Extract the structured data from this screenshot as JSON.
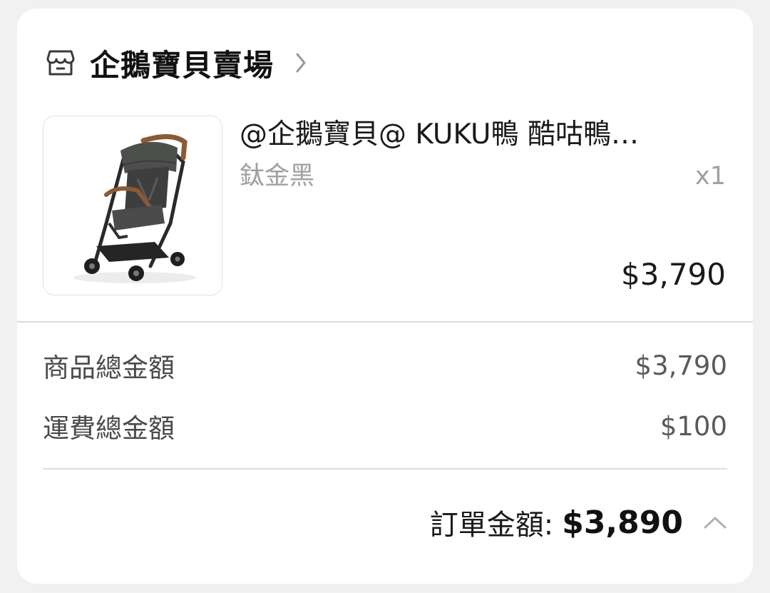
{
  "shop": {
    "name": "企鵝寶貝賣場"
  },
  "product": {
    "title": "@企鵝寶貝@ KUKU鴨 酷咕鴨…",
    "variant": "鈦金黑",
    "quantity": "x1",
    "price": "$3,790",
    "image_alt": "stroller"
  },
  "summary": {
    "subtotal_label": "商品總金額",
    "subtotal_value": "$3,790",
    "shipping_label": "運費總金額",
    "shipping_value": "$100"
  },
  "total": {
    "label": "訂單金額:",
    "value": "$3,890"
  },
  "colors": {
    "background": "#f1f1f1",
    "card": "#ffffff",
    "muted_text": "#a0a0a0",
    "divider": "#dcdcdc"
  },
  "icons": {
    "shop": "shop-icon",
    "expand": "chevron-right-icon",
    "collapse": "chevron-up-icon"
  }
}
